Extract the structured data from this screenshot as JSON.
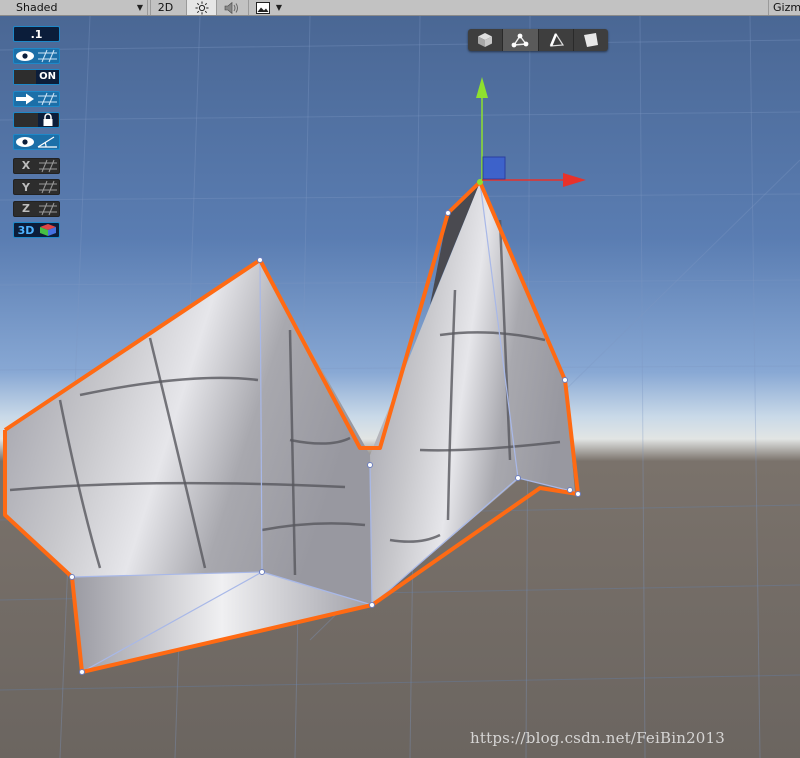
{
  "toolbar": {
    "shading_mode": "Shaded",
    "mode_2d": "2D",
    "lighting_icon": "sun-icon",
    "audio_icon": "speaker-icon",
    "effects_icon": "image-icon",
    "gizmos_label": "Gizm"
  },
  "gizmo_tools": [
    {
      "name": "object-mode",
      "icon": "cube-icon",
      "active": false
    },
    {
      "name": "vertex-mode",
      "icon": "vertex-icon",
      "active": true
    },
    {
      "name": "edge-mode",
      "icon": "edge-icon",
      "active": false
    },
    {
      "name": "face-mode",
      "icon": "face-icon",
      "active": false
    }
  ],
  "left_tools": {
    "snap_value": ".1",
    "toggle_on": "ON",
    "axis_x": "X",
    "axis_y": "Y",
    "axis_z": "Z",
    "mode_3d": "3D"
  },
  "colors": {
    "selection_outline": "#ff6a13",
    "axis_x": "#e8322a",
    "axis_y": "#8ee02e",
    "axis_z": "#3a5fd0",
    "tool_accent": "#1e88c8"
  },
  "watermark": "https://blog.csdn.net/FeiBin2013"
}
